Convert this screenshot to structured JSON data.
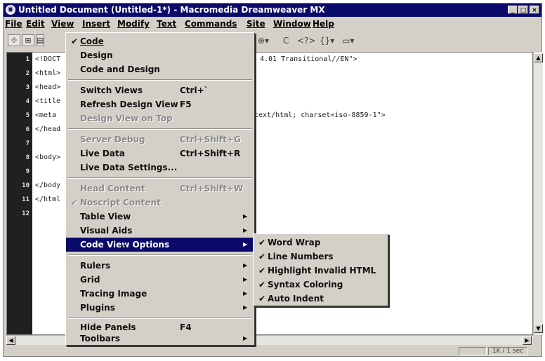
{
  "window": {
    "title": "Untitled Document (Untitled-1*) - Macromedia Dreamweaver MX",
    "controls": [
      "_",
      "□",
      "×"
    ]
  },
  "menubar": [
    "File",
    "Edit",
    "View",
    "Insert",
    "Modify",
    "Text",
    "Commands",
    "Site",
    "Window",
    "Help"
  ],
  "toolbar": {
    "icons": [
      "code-view-icon",
      "split-view-icon",
      "design-view-icon"
    ],
    "right_items": [
      "⊕▾",
      "C",
      "<?>",
      "{}▾",
      "▭▾"
    ]
  },
  "code": {
    "line_numbers": [
      "1",
      "2",
      "3",
      "4",
      "5",
      "6",
      "7",
      "8",
      "9",
      "10",
      "11",
      "12"
    ],
    "lines": [
      "<!DOCT",
      "<html>",
      "<head>",
      "<title",
      "<meta",
      "</head",
      "",
      "<body>",
      "",
      "</body",
      "</html",
      ""
    ],
    "visible_right": {
      "line1": "4.01 Transitional//EN\">",
      "line5": "\"text/html; charset=iso-8859-1\">"
    }
  },
  "view_menu": {
    "items": [
      {
        "label": "Code",
        "checked": true,
        "shortcut": "",
        "submenu": false,
        "disabled": false
      },
      {
        "label": "Design",
        "checked": false,
        "shortcut": "",
        "submenu": false,
        "disabled": false
      },
      {
        "label": "Code and Design",
        "checked": false,
        "shortcut": "",
        "submenu": false,
        "disabled": false
      },
      {
        "label": "Switch Views",
        "checked": false,
        "shortcut": "Ctrl+`",
        "submenu": false,
        "disabled": false
      },
      {
        "label": "Refresh Design View",
        "checked": false,
        "shortcut": "F5",
        "submenu": false,
        "disabled": false
      },
      {
        "label": "Design View on Top",
        "checked": false,
        "shortcut": "",
        "submenu": false,
        "disabled": true
      },
      {
        "label": "Server Debug",
        "checked": false,
        "shortcut": "Ctrl+Shift+G",
        "submenu": false,
        "disabled": true
      },
      {
        "label": "Live Data",
        "checked": false,
        "shortcut": "Ctrl+Shift+R",
        "submenu": false,
        "disabled": false
      },
      {
        "label": "Live Data Settings...",
        "checked": false,
        "shortcut": "",
        "submenu": false,
        "disabled": false
      },
      {
        "label": "Head Content",
        "checked": false,
        "shortcut": "Ctrl+Shift+W",
        "submenu": false,
        "disabled": true
      },
      {
        "label": "Noscript Content",
        "checked": true,
        "shortcut": "",
        "submenu": false,
        "disabled": true
      },
      {
        "label": "Table View",
        "checked": false,
        "shortcut": "",
        "submenu": true,
        "disabled": false
      },
      {
        "label": "Visual Aids",
        "checked": false,
        "shortcut": "",
        "submenu": true,
        "disabled": false
      },
      {
        "label": "Code View Options",
        "checked": false,
        "shortcut": "",
        "submenu": true,
        "disabled": false,
        "highlighted": true
      },
      {
        "label": "Rulers",
        "checked": false,
        "shortcut": "",
        "submenu": true,
        "disabled": false
      },
      {
        "label": "Grid",
        "checked": false,
        "shortcut": "",
        "submenu": true,
        "disabled": false
      },
      {
        "label": "Tracing Image",
        "checked": false,
        "shortcut": "",
        "submenu": true,
        "disabled": false
      },
      {
        "label": "Plugins",
        "checked": false,
        "shortcut": "",
        "submenu": true,
        "disabled": false
      },
      {
        "label": "Hide Panels",
        "checked": false,
        "shortcut": "F4",
        "submenu": false,
        "disabled": false
      },
      {
        "label": "Toolbars",
        "checked": false,
        "shortcut": "",
        "submenu": true,
        "disabled": false
      }
    ]
  },
  "code_view_options_menu": {
    "items": [
      {
        "label": "Word Wrap",
        "checked": true
      },
      {
        "label": "Line Numbers",
        "checked": true
      },
      {
        "label": "Highlight Invalid HTML",
        "checked": true
      },
      {
        "label": "Syntax Coloring",
        "checked": true
      },
      {
        "label": "Auto Indent",
        "checked": true
      }
    ]
  },
  "statusbar": {
    "size": "1K / 1 sec"
  }
}
